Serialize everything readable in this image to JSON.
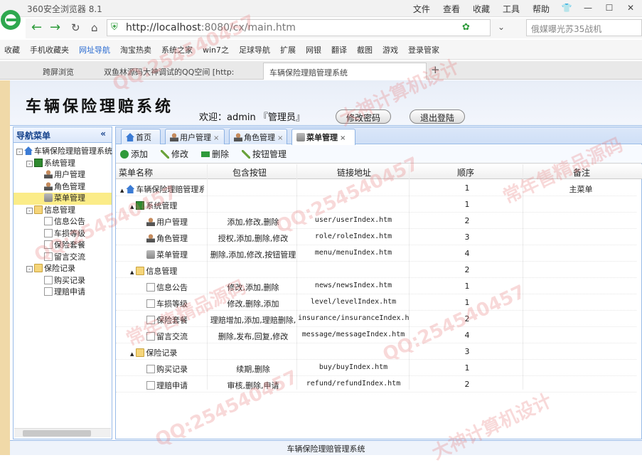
{
  "browser": {
    "app_title": "360安全浏览器 8.1",
    "menus": [
      "文件",
      "查看",
      "收藏",
      "工具",
      "帮助"
    ],
    "url_host": "http://localhost",
    "url_rest": ":8080/cx/main.htm",
    "search_placeholder": "俄媒曝光苏35战机",
    "favorites": [
      "收藏",
      "手机收藏夹",
      "网址导航",
      "淘宝热卖",
      "系统之家",
      "win7之",
      "足球导航",
      "扩展",
      "网银",
      "翻译",
      "截图",
      "游戏",
      "登录管家"
    ],
    "tabs": [
      "跨屏浏览",
      "双鱼林源码大神调试的QQ空间 [http:",
      "车辆保险理赔管理系统"
    ]
  },
  "header": {
    "title": "车辆保险理赔系统",
    "welcome": "欢迎：admin 『管理员』",
    "change_password": "修改密码",
    "logout": "退出登陆"
  },
  "nav": {
    "title": "导航菜单",
    "items": [
      {
        "label": "车辆保险理赔管理系统",
        "level": 0,
        "icon": "home",
        "toggle": "-"
      },
      {
        "label": "系统管理",
        "level": 1,
        "icon": "book",
        "toggle": "-"
      },
      {
        "label": "用户管理",
        "level": 2,
        "icon": "user"
      },
      {
        "label": "角色管理",
        "level": 2,
        "icon": "user"
      },
      {
        "label": "菜单管理",
        "level": 2,
        "icon": "tool",
        "selected": true
      },
      {
        "label": "信息管理",
        "level": 1,
        "icon": "folder",
        "toggle": "-"
      },
      {
        "label": "信息公告",
        "level": 2,
        "icon": "page"
      },
      {
        "label": "车损等级",
        "level": 2,
        "icon": "page"
      },
      {
        "label": "保险套餐",
        "level": 2,
        "icon": "page"
      },
      {
        "label": "留言交流",
        "level": 2,
        "icon": "page"
      },
      {
        "label": "保险记录",
        "level": 1,
        "icon": "folder",
        "toggle": "-"
      },
      {
        "label": "购买记录",
        "level": 2,
        "icon": "page"
      },
      {
        "label": "理赔申请",
        "level": 2,
        "icon": "page"
      }
    ]
  },
  "tabs": [
    {
      "label": "首页",
      "closable": false
    },
    {
      "label": "用户管理",
      "closable": true
    },
    {
      "label": "角色管理",
      "closable": true
    },
    {
      "label": "菜单管理",
      "closable": true,
      "active": true
    }
  ],
  "toolbar": {
    "add": "添加",
    "edit": "修改",
    "delete": "删除",
    "buttons": "按钮管理"
  },
  "grid": {
    "headers": [
      "菜单名称",
      "包含按钮",
      "链接地址",
      "顺序",
      "备注"
    ],
    "rows": [
      {
        "name": "车辆保险理赔管理系统",
        "level": 0,
        "icon": "home",
        "toggle": "▲",
        "buttons": "",
        "url": "",
        "order": "1",
        "note": "主菜单"
      },
      {
        "name": "系统管理",
        "level": 1,
        "icon": "book",
        "toggle": "▲",
        "buttons": "",
        "url": "",
        "order": "1",
        "note": ""
      },
      {
        "name": "用户管理",
        "level": 2,
        "icon": "user",
        "buttons": "添加,修改,删除",
        "url": "user/userIndex.htm",
        "order": "2",
        "note": ""
      },
      {
        "name": "角色管理",
        "level": 2,
        "icon": "user",
        "buttons": "授权,添加,删除,修改",
        "url": "role/roleIndex.htm",
        "order": "3",
        "note": ""
      },
      {
        "name": "菜单管理",
        "level": 2,
        "icon": "tool",
        "buttons": "删除,添加,修改,按钮管理",
        "url": "menu/menuIndex.htm",
        "order": "4",
        "note": ""
      },
      {
        "name": "信息管理",
        "level": 1,
        "icon": "folder",
        "toggle": "▲",
        "buttons": "",
        "url": "",
        "order": "2",
        "note": ""
      },
      {
        "name": "信息公告",
        "level": 2,
        "icon": "page",
        "buttons": "修改,添加,删除",
        "url": "news/newsIndex.htm",
        "order": "1",
        "note": ""
      },
      {
        "name": "车损等级",
        "level": 2,
        "icon": "page",
        "buttons": "修改,删除,添加",
        "url": "level/levelIndex.htm",
        "order": "1",
        "note": ""
      },
      {
        "name": "保险套餐",
        "level": 2,
        "icon": "page",
        "buttons": "理赔增加,添加,理赔删除,",
        "url": "insurance/insuranceIndex.htm",
        "order": "2",
        "note": ""
      },
      {
        "name": "留言交流",
        "level": 2,
        "icon": "page",
        "buttons": "删除,发布,回复,修改",
        "url": "message/messageIndex.htm",
        "order": "4",
        "note": ""
      },
      {
        "name": "保险记录",
        "level": 1,
        "icon": "folder",
        "toggle": "▲",
        "buttons": "",
        "url": "",
        "order": "3",
        "note": ""
      },
      {
        "name": "购买记录",
        "level": 2,
        "icon": "page",
        "buttons": "续期,删除",
        "url": "buy/buyIndex.htm",
        "order": "1",
        "note": ""
      },
      {
        "name": "理赔申请",
        "level": 2,
        "icon": "page",
        "buttons": "审核,删除,申请",
        "url": "refund/refundIndex.htm",
        "order": "2",
        "note": ""
      }
    ]
  },
  "footer": "车辆保险理赔管理系统",
  "watermarks": [
    "QQ:254540457",
    "大神计算机设计",
    "常年售精品源码"
  ]
}
